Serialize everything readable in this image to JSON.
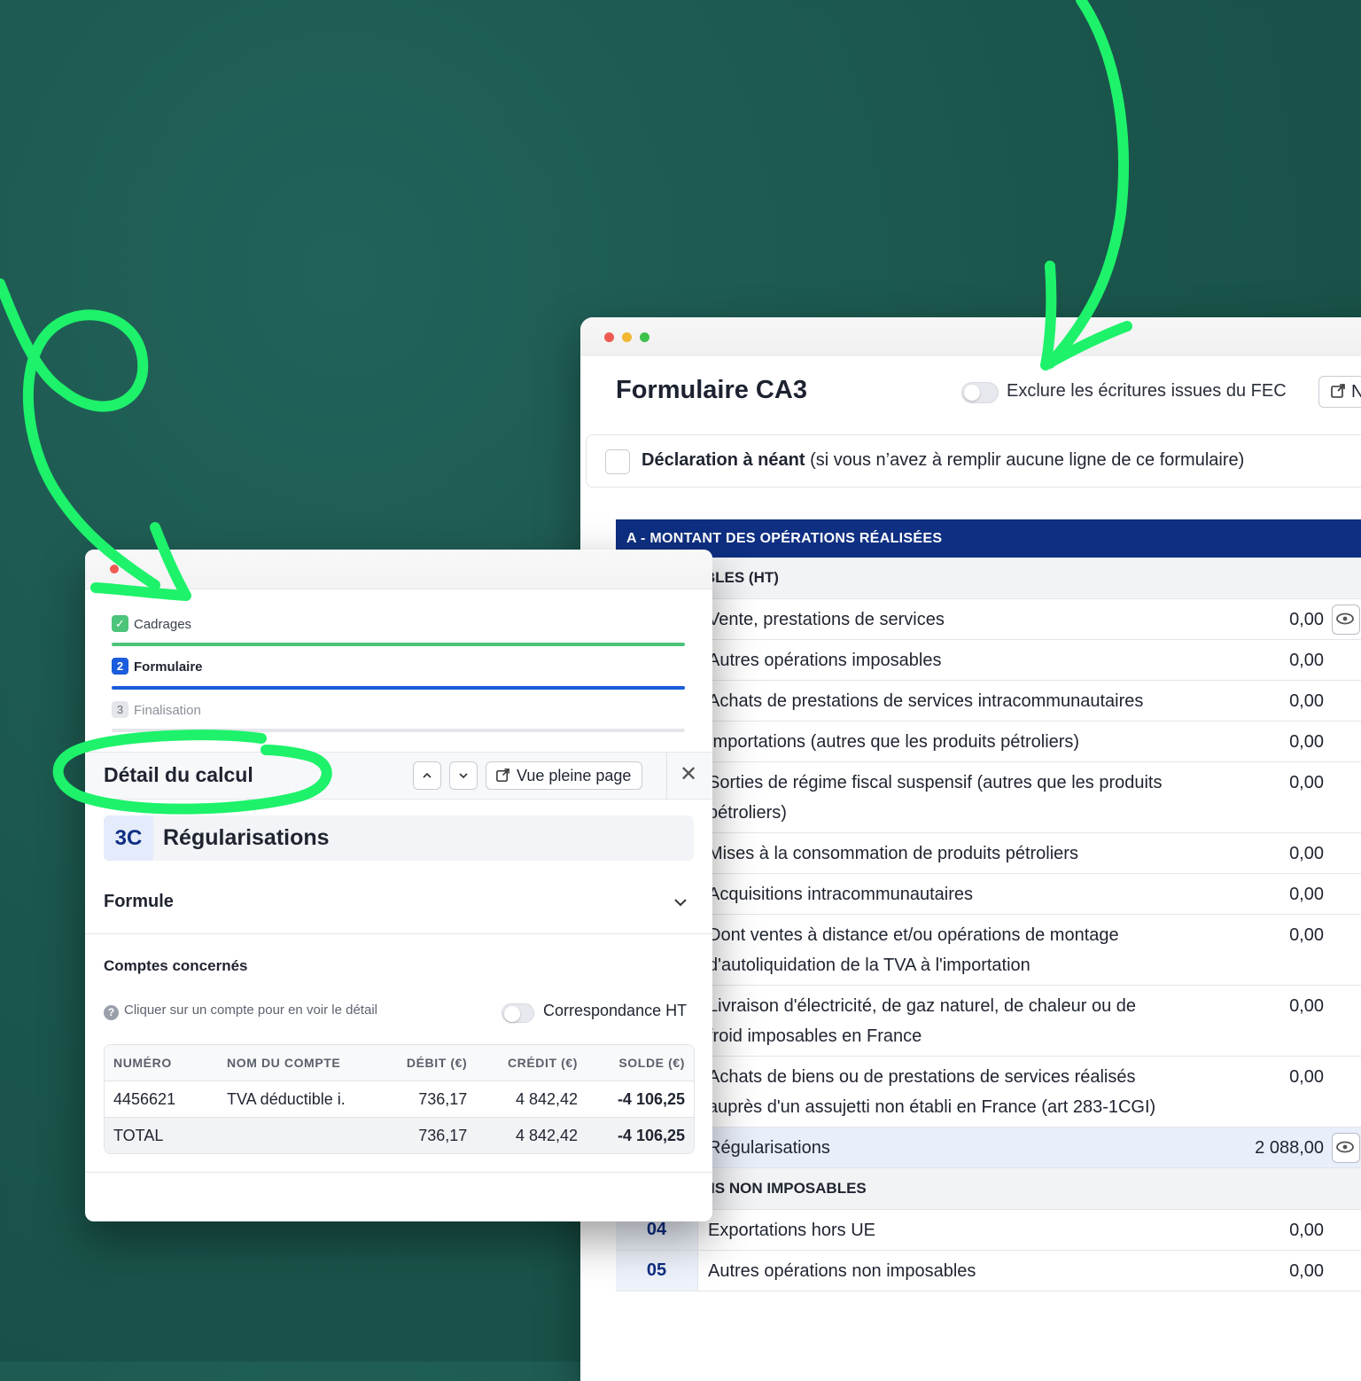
{
  "colors": {
    "background": "#1b574d",
    "accent_green": "#1df26a",
    "navy": "#0e2f82",
    "step_green": "#4cc47a",
    "step_blue": "#1a5cdb"
  },
  "form_window": {
    "title": "Formulaire CA3",
    "exclude_fec_label": "Exclure les écritures issues du FEC",
    "exclude_fec_on": false,
    "notice_button": "Notic",
    "neant_bold": "Déclaration à néant",
    "neant_rest": " (si vous n’avez à remplir aucune ligne de ce formulaire)",
    "section_a_title": "A - MONTANT DES OPÉRATIONS RÉALISÉES",
    "imposables_title": "IS IMPOSABLES (HT)",
    "rows_imposables": [
      {
        "label": "Vente, prestations de services",
        "value": "0,00"
      },
      {
        "label": "Autres opérations imposables",
        "value": "0,00"
      },
      {
        "label": "Achats de prestations de services intracommunautaires",
        "value": "0,00"
      },
      {
        "label": "Importations (autres que les produits pétroliers)",
        "value": "0,00"
      },
      {
        "label": "Sorties de régime fiscal suspensif (autres que les produits pétroliers)",
        "value": "0,00"
      },
      {
        "label": "Mises à la consommation de produits pétroliers",
        "value": "0,00"
      },
      {
        "label": "Acquisitions intracommunautaires",
        "value": "0,00"
      },
      {
        "label": "Dont ventes à distance et/ou opérations de montage d'autoliquidation de la TVA à l'importation",
        "value": "0,00"
      },
      {
        "label": "Livraison d'électricité, de gaz naturel, de chaleur ou de froid imposables en France",
        "value": "0,00"
      },
      {
        "label": "Achats de biens ou de prestations de services réalisés auprès d'un assujetti non établi en France (art 283-1CGI)",
        "value": "0,00"
      },
      {
        "label": "Régularisations",
        "value": "2 088,00"
      }
    ],
    "non_imposables_title": "OPÉRATIONS NON IMPOSABLES",
    "rows_non_imposables": [
      {
        "code": "04",
        "label": "Exportations hors UE",
        "value": "0,00"
      },
      {
        "code": "05",
        "label": "Autres opérations non imposables",
        "value": "0,00"
      }
    ]
  },
  "detail_panel": {
    "steps": [
      {
        "number": "✓",
        "label": "Cadrages",
        "state": "done"
      },
      {
        "number": "2",
        "label": "Formulaire",
        "state": "active"
      },
      {
        "number": "3",
        "label": "Finalisation",
        "state": "pending"
      }
    ],
    "title": "Détail du calcul",
    "full_page_button": "Vue pleine page",
    "close_icon": "close-icon",
    "code": "3C",
    "code_label": "Régularisations",
    "formule_label": "Formule",
    "comptes_title": "Comptes concernés",
    "hint": "Cliquer sur un compte pour en voir le détail",
    "correspondance_label": "Correspondance HT",
    "correspondance_on": false,
    "table": {
      "headers": [
        "NUMÉRO",
        "NOM DU COMPTE",
        "DÉBIT (€)",
        "CRÉDIT (€)",
        "SOLDE (€)"
      ],
      "rows": [
        [
          "4456621",
          "TVA déductible i.",
          "736,17",
          "4 842,42",
          "-4 106,25"
        ]
      ],
      "total": [
        "TOTAL",
        "",
        "736,17",
        "4 842,42",
        "-4 106,25"
      ]
    }
  }
}
